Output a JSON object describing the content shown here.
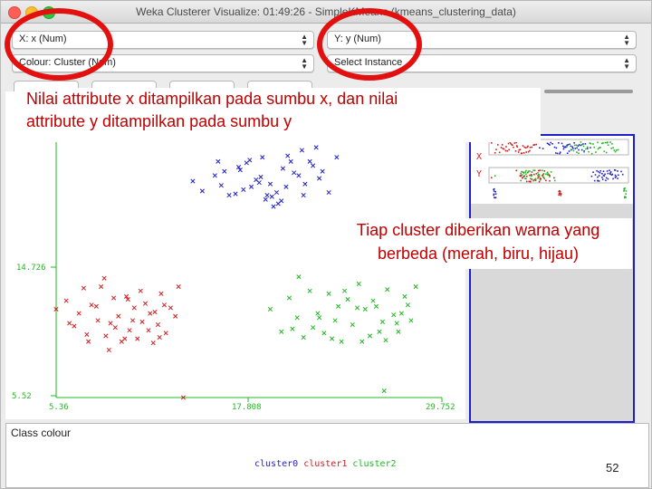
{
  "window": {
    "title": "Weka Clusterer Visualize: 01:49:26 - SimpleKMeans (kmeans_clustering_data)"
  },
  "controls": {
    "x_axis": "X: x (Num)",
    "y_axis": "Y: y (Num)",
    "colour": "Colour: Cluster (Nom)",
    "instance": "Select Instance"
  },
  "annotations": {
    "axis_note_line1": "Nilai attribute x ditampilkan pada sumbu x, dan nilai",
    "axis_note_line2": "attribute y ditampilkan pada sumbu y",
    "cluster_note_line1": "Tiap cluster diberikan warna yang",
    "cluster_note_line2": "berbeda (merah, biru, hijau)"
  },
  "side_panel": {
    "x_label": "X",
    "y_label": "Y"
  },
  "class_colour": {
    "heading": "Class colour",
    "items": [
      {
        "label": "cluster0",
        "color": "#2222cc"
      },
      {
        "label": "cluster1",
        "color": "#d11f1f"
      },
      {
        "label": "cluster2",
        "color": "#22b822"
      }
    ]
  },
  "page_number": "52",
  "colors": {
    "axis": "#22b822",
    "annotation_text": "#c00000",
    "highlight_ring": "#e31010"
  },
  "chart_data": {
    "type": "scatter",
    "title": "",
    "xlabel": "x",
    "ylabel": "y",
    "xlim": [
      5.36,
      29.752
    ],
    "ylim": [
      5.52,
      23.93
    ],
    "x_tick_labels": [
      "5.36",
      "17.808",
      "29.752"
    ],
    "y_tick_labels": [
      "5.52",
      "14.726"
    ],
    "marker": "x",
    "series": [
      {
        "name": "cluster0",
        "color": "#2222cc",
        "x": [
          14.0,
          14.6,
          15.4,
          15.8,
          16.7,
          17.0,
          17.4,
          17.7,
          18.3,
          18.6,
          18.9,
          19.3,
          19.7,
          20.2,
          20.7,
          21.1,
          21.6,
          22.2,
          22.6,
          23.1,
          15.6,
          16.0,
          16.9,
          17.2,
          18.0,
          18.4,
          19.0,
          19.4,
          19.9,
          20.4,
          21.0,
          21.4,
          21.8,
          17.6,
          18.7,
          19.1,
          20.0,
          20.9,
          16.3,
          22.0,
          18.2,
          19.6
        ],
        "y": [
          20.9,
          20.2,
          21.3,
          20.6,
          20.0,
          21.7,
          22.2,
          20.5,
          21.2,
          19.6,
          20.7,
          20.1,
          21.8,
          22.3,
          21.3,
          20.7,
          22.0,
          21.6,
          20.1,
          22.6,
          22.3,
          21.6,
          21.9,
          20.3,
          21.0,
          22.6,
          19.8,
          19.3,
          20.5,
          21.5,
          19.9,
          22.3,
          23.3,
          22.4,
          19.9,
          19.1,
          22.7,
          23.1,
          19.9,
          21.1,
          20.8,
          19.5
        ]
      },
      {
        "name": "cluster1",
        "color": "#d11f1f",
        "x": [
          5.36,
          6.0,
          6.5,
          6.8,
          7.1,
          7.3,
          7.6,
          8.0,
          8.2,
          8.5,
          8.8,
          9.0,
          9.3,
          9.5,
          9.8,
          10.0,
          10.3,
          10.5,
          10.8,
          11.0,
          11.3,
          11.5,
          11.8,
          12.0,
          12.3,
          12.6,
          12.9,
          13.1,
          7.9,
          8.4,
          9.1,
          9.7,
          10.2,
          10.7,
          11.2,
          11.6,
          12.2,
          6.2,
          7.4,
          8.7,
          9.9,
          11.9,
          13.4
        ],
        "y": [
          11.8,
          12.4,
          10.6,
          11.5,
          13.3,
          10.0,
          12.1,
          11.0,
          13.4,
          9.9,
          10.8,
          12.6,
          11.3,
          9.5,
          12.7,
          10.3,
          11.9,
          9.7,
          10.9,
          12.2,
          11.5,
          9.4,
          10.7,
          12.9,
          10.1,
          11.9,
          11.3,
          13.4,
          12.0,
          14.0,
          10.5,
          9.7,
          11.0,
          13.1,
          10.3,
          11.6,
          12.1,
          10.8,
          9.5,
          8.9,
          12.5,
          9.8,
          5.52
        ]
      },
      {
        "name": "cluster2",
        "color": "#22b822",
        "x": [
          18.9,
          19.6,
          20.1,
          20.6,
          21.0,
          21.4,
          21.9,
          22.3,
          22.6,
          23.0,
          23.4,
          23.8,
          24.1,
          24.5,
          24.9,
          25.2,
          25.6,
          26.0,
          26.3,
          26.7,
          27.0,
          27.4,
          27.8,
          28.1,
          20.7,
          21.6,
          22.8,
          23.6,
          24.4,
          25.4,
          26.2,
          26.9,
          27.6,
          22.0,
          23.2,
          24.7,
          25.8,
          20.3,
          27.2,
          26.1
        ],
        "y": [
          11.8,
          10.2,
          12.6,
          11.2,
          9.8,
          13.1,
          11.5,
          10.1,
          12.9,
          11.0,
          9.5,
          12.5,
          10.7,
          13.6,
          11.8,
          9.9,
          12.0,
          10.9,
          13.2,
          11.4,
          10.2,
          12.7,
          11.0,
          13.4,
          14.1,
          10.5,
          9.7,
          13.1,
          11.9,
          12.4,
          9.6,
          10.8,
          12.1,
          11.2,
          12.0,
          9.5,
          10.2,
          10.4,
          11.5,
          6.0
        ]
      }
    ]
  }
}
